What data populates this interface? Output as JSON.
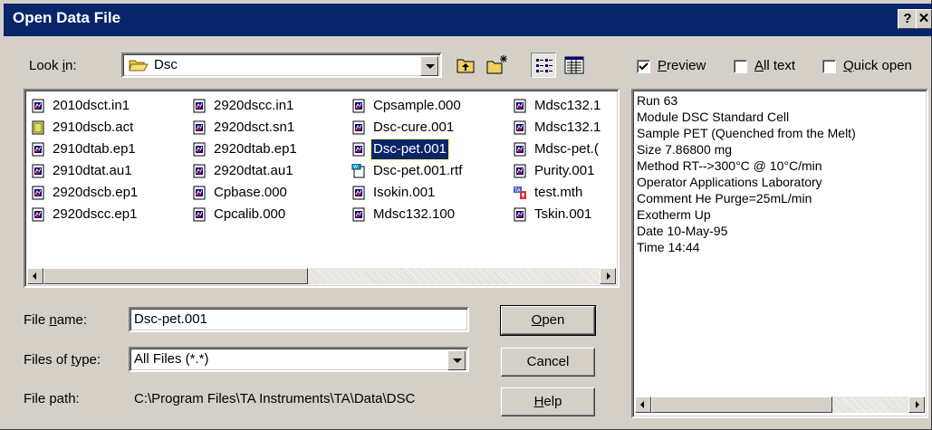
{
  "dialog": {
    "title": "Open Data File",
    "help_glyph": "?",
    "close_glyph": "✕"
  },
  "look_in": {
    "label_pre": "Look ",
    "label_u": "i",
    "label_post": "n:",
    "value": "Dsc"
  },
  "options": {
    "preview": {
      "pre": "",
      "u": "P",
      "post": "review",
      "checked": true
    },
    "all_text": {
      "pre": "",
      "u": "A",
      "post": "ll text",
      "checked": false
    },
    "quick_open": {
      "pre": "",
      "u": "Q",
      "post": "uick open",
      "checked": false
    }
  },
  "files": {
    "col1": [
      {
        "name": "2010dsct.in1",
        "icon": "data-file-icon"
      },
      {
        "name": "2910dscb.act",
        "icon": "generic-file-icon"
      },
      {
        "name": "2910dtab.ep1",
        "icon": "data-file-icon"
      },
      {
        "name": "2910dtat.au1",
        "icon": "data-file-icon"
      },
      {
        "name": "2920dscb.ep1",
        "icon": "data-file-icon"
      },
      {
        "name": "2920dscc.ep1",
        "icon": "data-file-icon"
      }
    ],
    "col2": [
      {
        "name": "2920dscc.in1",
        "icon": "data-file-icon"
      },
      {
        "name": "2920dsct.sn1",
        "icon": "data-file-icon"
      },
      {
        "name": "2920dtab.ep1",
        "icon": "data-file-icon"
      },
      {
        "name": "2920dtat.au1",
        "icon": "data-file-icon"
      },
      {
        "name": "Cpbase.000",
        "icon": "data-file-icon"
      },
      {
        "name": "Cpcalib.000",
        "icon": "data-file-icon"
      }
    ],
    "col3": [
      {
        "name": "Cpsample.000",
        "icon": "data-file-icon"
      },
      {
        "name": "Dsc-cure.001",
        "icon": "data-file-icon"
      },
      {
        "name": "Dsc-pet.001",
        "icon": "data-file-icon",
        "selected": true
      },
      {
        "name": "Dsc-pet.001.rtf",
        "icon": "wordpad-icon"
      },
      {
        "name": "Isokin.001",
        "icon": "data-file-icon"
      },
      {
        "name": "Mdsc132.100",
        "icon": "data-file-icon"
      }
    ],
    "col4": [
      {
        "name": "Mdsc132.1",
        "icon": "data-file-icon"
      },
      {
        "name": "Mdsc132.1",
        "icon": "data-file-icon"
      },
      {
        "name": "Mdsc-pet.(",
        "icon": "data-file-icon"
      },
      {
        "name": "Purity.001",
        "icon": "data-file-icon"
      },
      {
        "name": "test.mth",
        "icon": "method-file-icon"
      },
      {
        "name": "Tskin.001",
        "icon": "data-file-icon"
      }
    ]
  },
  "file_name": {
    "pre": "File ",
    "u": "n",
    "post": "ame:",
    "value": "Dsc-pet.001"
  },
  "files_of_type": {
    "pre": "Files of ",
    "u": "t",
    "post": "ype:",
    "value": "All Files (*.*)"
  },
  "file_path": {
    "label": "File path:",
    "value": "C:\\Program Files\\TA Instruments\\TA\\Data\\DSC"
  },
  "buttons": {
    "open": {
      "pre": "",
      "u": "O",
      "post": "pen"
    },
    "cancel": "Cancel",
    "help": {
      "pre": "",
      "u": "H",
      "post": "elp"
    }
  },
  "preview_text": [
    "Run 63",
    "Module DSC Standard Cell",
    "Sample PET (Quenched from the Melt)",
    "Size 7.86800 mg",
    "Method RT-->300°C @ 10°C/min",
    "Operator Applications Laboratory",
    "Comment He Purge=25mL/min",
    "Exotherm Up",
    "Date 10-May-95",
    "Time 14:44"
  ],
  "colors": {
    "title_bar": "#08246b",
    "selection": "#0a246a",
    "face": "#d4d0c8"
  }
}
